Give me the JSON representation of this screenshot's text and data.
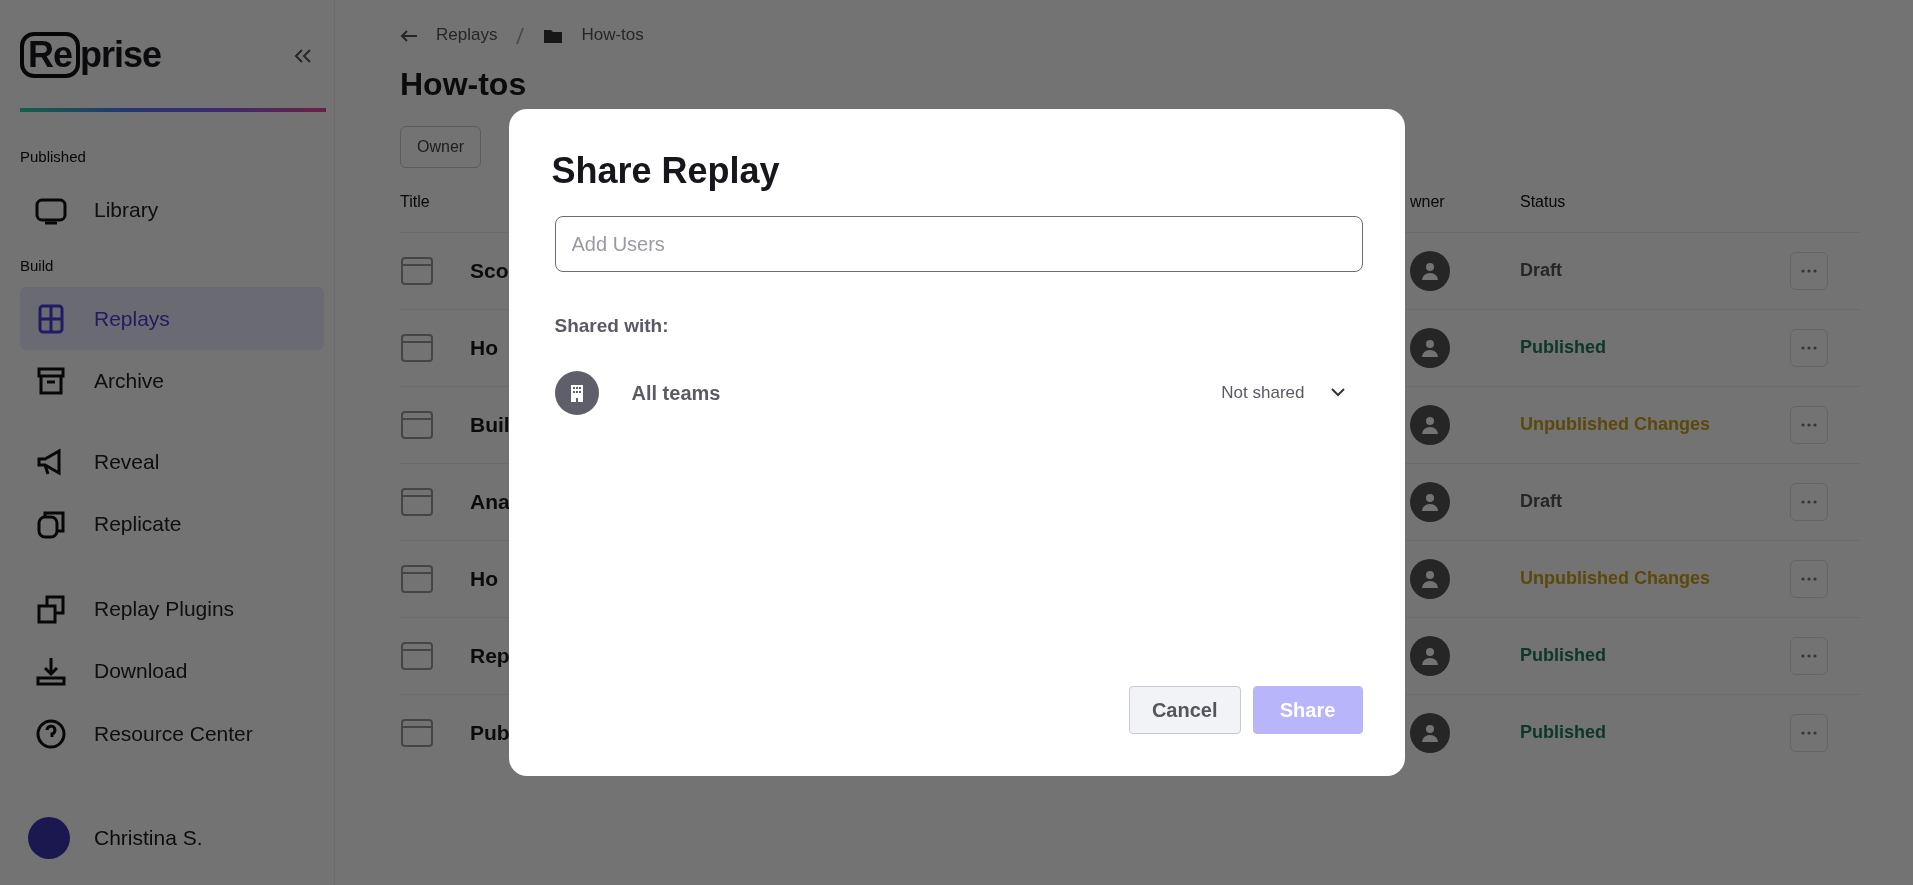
{
  "sidebar": {
    "logo": {
      "boxed": "Re",
      "rest": "prise"
    },
    "groups": [
      {
        "label": "Published",
        "items": [
          {
            "label": "Library",
            "selected": false
          }
        ]
      },
      {
        "label": "Build",
        "items": [
          {
            "label": "Replays",
            "selected": true
          },
          {
            "label": "Archive",
            "selected": false
          }
        ]
      },
      {
        "items": [
          {
            "label": "Reveal",
            "selected": false
          },
          {
            "label": "Replicate",
            "selected": false
          }
        ]
      }
    ],
    "footer_items": [
      {
        "label": "Replay Plugins",
        "selected": false
      },
      {
        "label": "Download",
        "selected": false
      },
      {
        "label": "Resource Center",
        "selected": false
      }
    ],
    "user": {
      "name": "Christina S."
    }
  },
  "breadcrumb": [
    {
      "label": "Replays",
      "kind": "link"
    },
    {
      "label": "How-tos",
      "kind": "folder"
    }
  ],
  "page_title": "How-tos",
  "filter_button": "Owner",
  "table": {
    "columns": [
      "Title",
      "wner",
      "Status"
    ],
    "rows": [
      {
        "title": "Sco",
        "status": "Draft",
        "kind": "draft"
      },
      {
        "title": "Ho",
        "status": "Published",
        "kind": "published"
      },
      {
        "title": "Buil",
        "status": "Unpublished Changes",
        "kind": "unpublished"
      },
      {
        "title": "Ana",
        "status": "Draft",
        "kind": "draft"
      },
      {
        "title": "Ho",
        "status": "Unpublished Changes",
        "kind": "unpublished"
      },
      {
        "title": "Rep",
        "status": "Published",
        "kind": "published"
      },
      {
        "title": "Pub",
        "status": "Published",
        "kind": "published"
      }
    ]
  },
  "dialog": {
    "title": "Share Replay",
    "input": {
      "placeholder": "Add Users"
    },
    "shared_with_label": "Shared with:",
    "entries": [
      {
        "name": "All teams",
        "access": "Not shared"
      }
    ],
    "buttons": [
      {
        "label": "Cancel",
        "kind": "secondary",
        "disabled": false
      },
      {
        "label": "Share",
        "kind": "primary",
        "disabled": true
      }
    ]
  }
}
